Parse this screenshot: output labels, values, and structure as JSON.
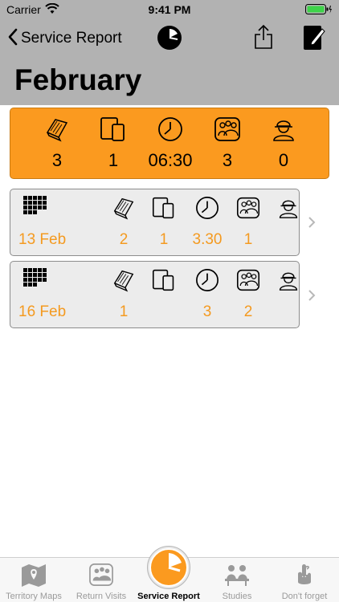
{
  "status_bar": {
    "carrier": "Carrier",
    "time": "9:41 PM"
  },
  "nav": {
    "back_label": "Service Report"
  },
  "header": {
    "month": "February"
  },
  "summary": {
    "placements": "3",
    "videos": "1",
    "hours": "06:30",
    "return_visits": "3",
    "studies": "0"
  },
  "entries": [
    {
      "date": "13 Feb",
      "placements": "2",
      "videos": "1",
      "hours": "3.30",
      "return_visits": "1",
      "studies": ""
    },
    {
      "date": "16 Feb",
      "placements": "1",
      "videos": "",
      "hours": "3",
      "return_visits": "2",
      "studies": ""
    }
  ],
  "tabs": [
    {
      "label": "Territory Maps",
      "icon": "map-icon"
    },
    {
      "label": "Return Visits",
      "icon": "return-visits-icon"
    },
    {
      "label": "Service Report",
      "icon": "clock-icon"
    },
    {
      "label": "Studies",
      "icon": "studies-icon"
    },
    {
      "label": "Don't forget",
      "icon": "finger-ribbon-icon"
    }
  ],
  "colors": {
    "header_bg": "#b2b2b2",
    "accent": "#fb9a1f",
    "entry_value": "#f49a20",
    "row_bg": "#ececec"
  }
}
